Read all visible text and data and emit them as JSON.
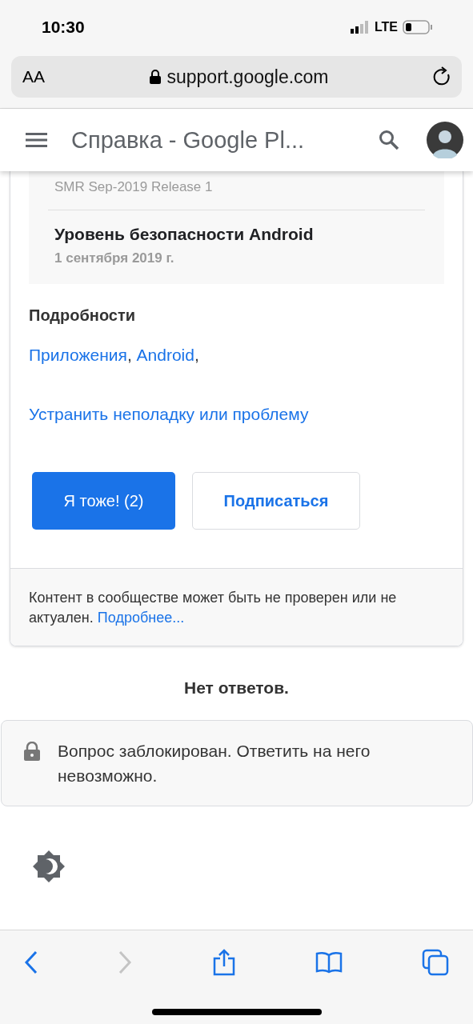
{
  "status_bar": {
    "time": "10:30",
    "network": "LTE"
  },
  "address_bar": {
    "text_size": "AA",
    "url": "support.google.com"
  },
  "header": {
    "title": "Справка - Google Pl..."
  },
  "info_rows": [
    {
      "title": "SMR Sep-2019 Release 1",
      "kind": "sub"
    },
    {
      "title": "Уровень безопасности Android",
      "subtitle": "1 сентября 2019 г.",
      "kind": "full"
    }
  ],
  "details": {
    "heading": "Подробности",
    "tags": [
      "Приложения",
      "Android"
    ],
    "separator": ",",
    "action_link": "Устранить неполадку или проблему"
  },
  "buttons": [
    {
      "label": "Я тоже! (2)",
      "kind": "primary"
    },
    {
      "label": "Подписаться",
      "kind": "outline"
    }
  ],
  "notice": {
    "text": "Контент в сообществе может быть не проверен или не актуален.",
    "link": "Подробнее..."
  },
  "no_answers": "Нет ответов.",
  "locked": {
    "text": "Вопрос заблокирован. Ответить на него невозможно."
  },
  "toolbar": [
    {
      "kind": "back",
      "disabled": false
    },
    {
      "kind": "forward",
      "disabled": true
    },
    {
      "kind": "share",
      "disabled": false
    },
    {
      "kind": "bookmarks",
      "disabled": false
    },
    {
      "kind": "tabs",
      "disabled": false
    }
  ]
}
